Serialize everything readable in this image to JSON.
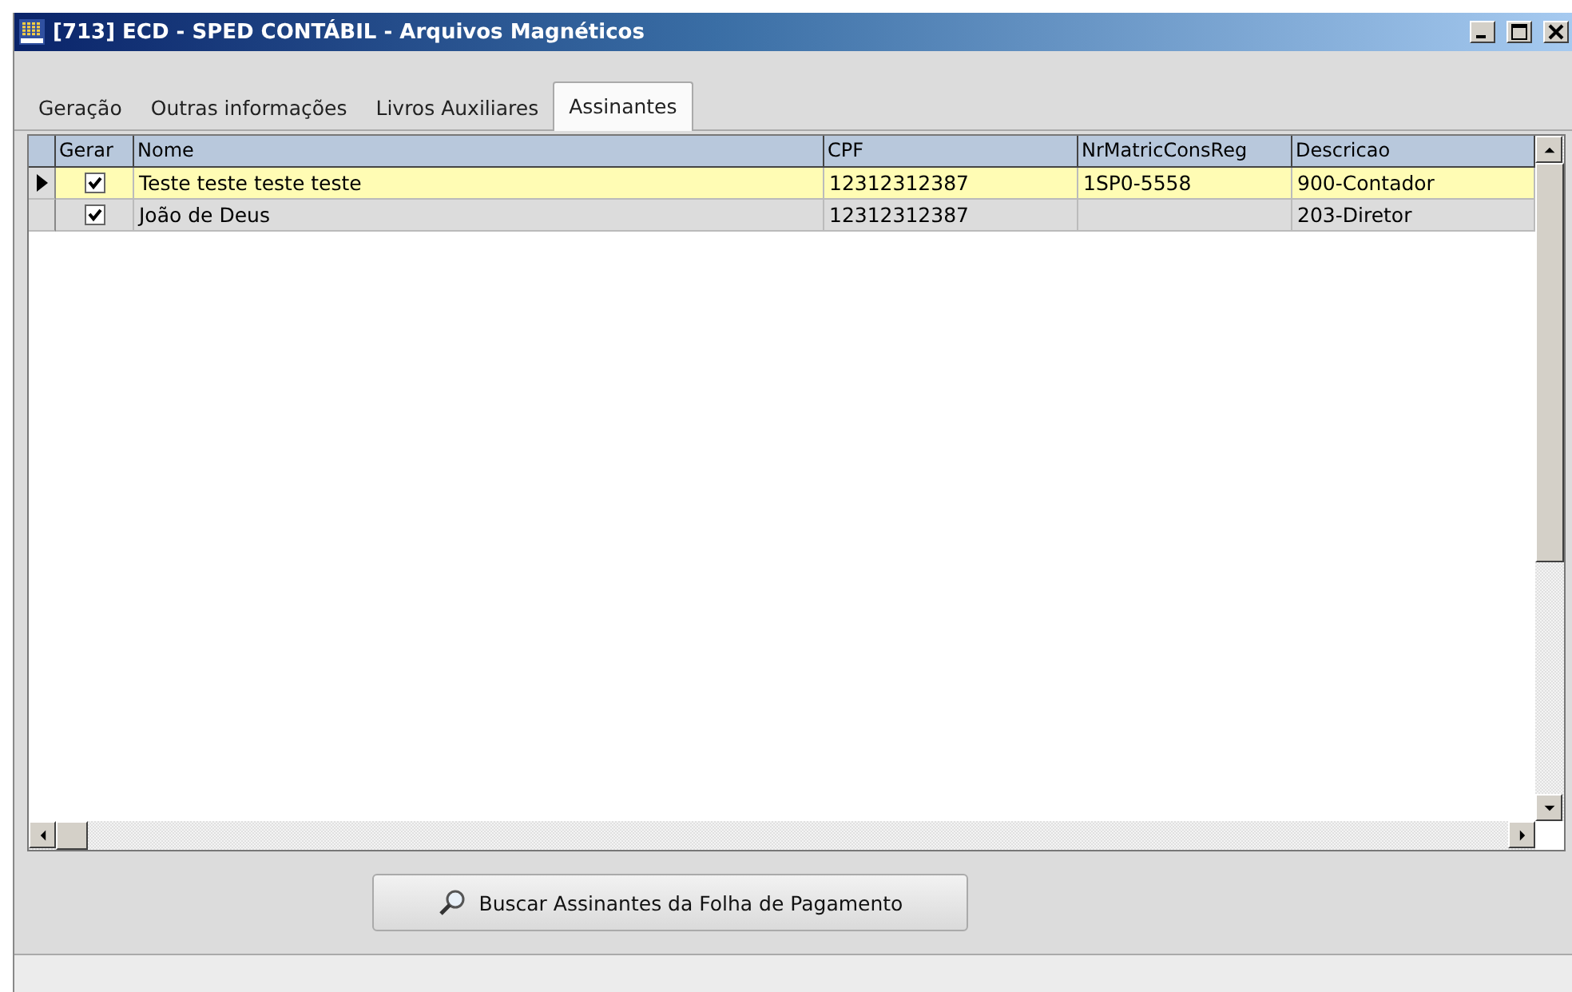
{
  "window": {
    "title": "[713] ECD - SPED CONTÁBIL  - Arquivos Magnéticos"
  },
  "tabs": [
    {
      "label": "Geração",
      "selected": false
    },
    {
      "label": "Outras informações",
      "selected": false
    },
    {
      "label": "Livros Auxiliares",
      "selected": false
    },
    {
      "label": "Assinantes",
      "selected": true
    }
  ],
  "table": {
    "columns": [
      "Gerar",
      "Nome",
      "CPF",
      "NrMatricConsReg",
      "Descricao"
    ],
    "rows": [
      {
        "selected": true,
        "gerar": true,
        "nome": "Teste teste teste teste",
        "cpf": "12312312387",
        "nrmatricconsreg": "1SP0-5558",
        "descricao": "900-Contador"
      },
      {
        "selected": false,
        "gerar": true,
        "nome": "João de Deus",
        "cpf": "12312312387",
        "descricao": "203-Diretor"
      }
    ]
  },
  "button": {
    "label": "Buscar Assinantes da Folha de Pagamento"
  }
}
